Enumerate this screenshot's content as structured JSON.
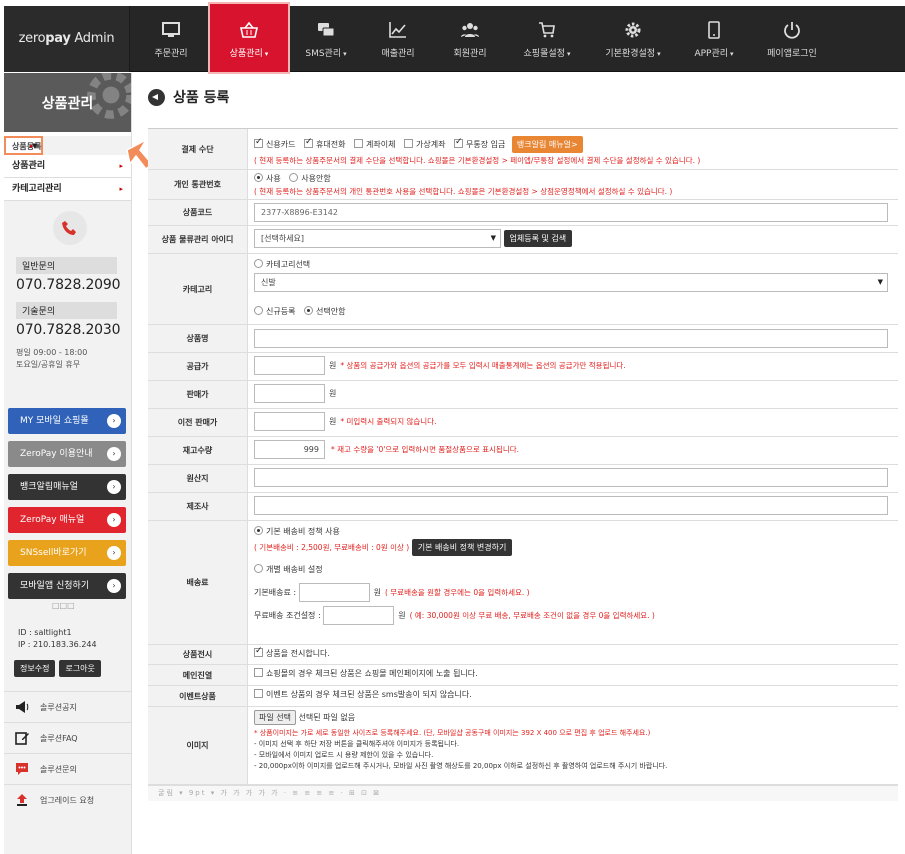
{
  "brand": {
    "logo_prefix": "zero",
    "logo_bold": "pay",
    "logo_suffix": " Admin"
  },
  "nav": [
    {
      "label": "주문관리",
      "icon": "monitor-icon"
    },
    {
      "label": "상품관리",
      "icon": "basket-icon",
      "active": true,
      "caret": "▾"
    },
    {
      "label": "SMS관리",
      "icon": "chat-icon",
      "caret": "▾"
    },
    {
      "label": "매출관리",
      "icon": "chart-icon"
    },
    {
      "label": "회원관리",
      "icon": "users-icon"
    },
    {
      "label": "쇼핑몰설정",
      "icon": "cart-icon",
      "caret": "▾"
    },
    {
      "label": "기본환경설정",
      "icon": "gear-icon",
      "caret": "▾"
    },
    {
      "label": "APP관리",
      "icon": "phone-icon",
      "caret": "▾"
    },
    {
      "label": "페이앱로그인",
      "icon": "power-icon"
    }
  ],
  "sidebar": {
    "title": "상품관리",
    "menu": [
      {
        "label": "상품등록",
        "arrow": "▸",
        "selected": true
      },
      {
        "label": "상품관리",
        "arrow": "▸"
      },
      {
        "label": "카테고리관리",
        "arrow": "▸"
      }
    ],
    "contact": {
      "general_label": "일반문의",
      "general_number": "070.7828.2090",
      "tech_label": "기술문의",
      "tech_number": "070.7828.2030",
      "hours1": "평일 09:00 - 18:00",
      "hours2": "토요일/공휴일 휴무"
    },
    "buttons": [
      {
        "label": "MY 모바일 쇼핑몰",
        "color": "#2f62b8"
      },
      {
        "label": "ZeroPay 이용안내",
        "color": "#8a8a8a"
      },
      {
        "label": "뱅크알림매뉴얼",
        "color": "#333333"
      },
      {
        "label": "ZeroPay 매뉴얼",
        "color": "#e1252f"
      },
      {
        "label": "SNSsell바로가기",
        "color": "#e9a21b"
      },
      {
        "label": "모바일앱 신청하기",
        "color": "#333333"
      }
    ],
    "button_arrow": "›",
    "dots": "□□□",
    "user": {
      "id": "ID : saltlight1",
      "ip": "IP : 210.183.36.244",
      "edit": "정보수정",
      "logout": "로그아웃"
    },
    "links": [
      {
        "label": "솔루션공지",
        "icon": "megaphone-icon"
      },
      {
        "label": "솔루션FAQ",
        "icon": "edit-icon"
      },
      {
        "label": "솔루션문의",
        "icon": "chat-icon"
      },
      {
        "label": "업그레이드 요청",
        "icon": "upload-icon"
      }
    ]
  },
  "page": {
    "title": "상품 등록"
  },
  "form": {
    "payment": {
      "label": "결제 수단",
      "options": [
        {
          "label": "신용카드",
          "checked": true
        },
        {
          "label": "휴대전화",
          "checked": true
        },
        {
          "label": "계좌이체",
          "checked": false
        },
        {
          "label": "가상계좌",
          "checked": false
        },
        {
          "label": "무통장 입금",
          "checked": true
        }
      ],
      "button": "뱅크알림 매뉴얼>",
      "note": "( 현재 등록하는 상품주문서의 결제 수단을 선택합니다. 쇼핑몰은 기본환경설정 > 페이앱/무통장 설정에서 결제 수단을 설정하실 수 있습니다. )"
    },
    "customs": {
      "label": "개인 통관번호",
      "use": "사용",
      "nouse": "사용안함",
      "note": "( 현재 등록하는 상품주문서의 개인 통관번호 사용을 선택합니다. 쇼핑몰은 기본환경설정 > 상점운영정책에서 설정하실 수 있습니다. )"
    },
    "code": {
      "label": "상품코드",
      "value": "2377-X8896-E3142"
    },
    "logistics": {
      "label": "상품 물류관리 아이디",
      "select": "[선택하세요]",
      "button": "업체등록 및 검색"
    },
    "category": {
      "label": "카테고리",
      "radio": "카테고리선택",
      "select": "신발",
      "new": "신규등록",
      "none": "선택안함"
    },
    "name": {
      "label": "상품명"
    },
    "supply": {
      "label": "공급가",
      "unit": "원",
      "note": "* 상품의 공급가와 옵션의 공급가를 모두 입력시 매출통계에는 옵션의 공급가만 적용됩니다."
    },
    "price": {
      "label": "판매가",
      "unit": "원"
    },
    "prev_price": {
      "label": "이전 판매가",
      "unit": "원",
      "note": "* 미입력시 출력되지 않습니다."
    },
    "stock": {
      "label": "재고수량",
      "value": "999",
      "note": "* 재고 수량을 '0'으로 입력하시면 품절상품으로 표시됩니다."
    },
    "origin": {
      "label": "원산지"
    },
    "maker": {
      "label": "제조사"
    },
    "shipping": {
      "label": "배송료",
      "basic": "기본 배송비 정책 사용",
      "basic_note": "( 기본배송비 : 2,500원, 무료배송비 : 0원 이상 )",
      "basic_button": "기본 배송비 정책 변경하기",
      "individual": "개별 배송비 설정",
      "fee_label": "기본배송료 :",
      "fee_unit": "원",
      "fee_note": "( 무료배송을 원할 경우에는 0을 입력하세요. )",
      "free_label": "무료배송 조건설정 :",
      "free_unit": "원",
      "free_note": "( 예: 30,000원 이상 무료 배송, 무료배송 조건이 없을 경우 0을 입력하세요. )"
    },
    "display": {
      "label": "상품전시",
      "text": "상품을 전시합니다."
    },
    "main_display": {
      "label": "메인진열",
      "text": "쇼핑몰의 경우 체크된 상품은 쇼핑몰 메인페이지에 노출 됩니다."
    },
    "event": {
      "label": "이벤트상품",
      "text": "이벤트 상품의 경우 체크된 상품은 sms발송이 되지 않습니다."
    },
    "image": {
      "label": "이미지",
      "file_button": "파일 선택",
      "file_status": "선택된 파일 없음",
      "note1": "* 상품이미지는 가로 세로 동일한 사이즈로 등록해주세요. (단, 모바일샵 공동구매 이미지는 392 X 400 으로 편집 후 업로드 해주세요.)",
      "note2": "- 이미지 선택 후 하단 저장 버튼을 클릭해주셔야 이미지가 등록됩니다.",
      "note3": "- 모바일에서 이미지 업로드 시 용량 제한이 있을 수 있습니다.",
      "note4": "- 20,000px이하 이미지를 업로드해 주시거나, 모바일 사진 촬영 해상도를 20,00px 이하로 설정하신 후 촬영하여 업로드해 주시기 바랍니다."
    },
    "toolbar": "굴림  ▾  9pt ▾  가 가 가 가 가  ·  ≡ ≡ ≡ ≡  ·  ⊞ ⊡ ⊠"
  }
}
